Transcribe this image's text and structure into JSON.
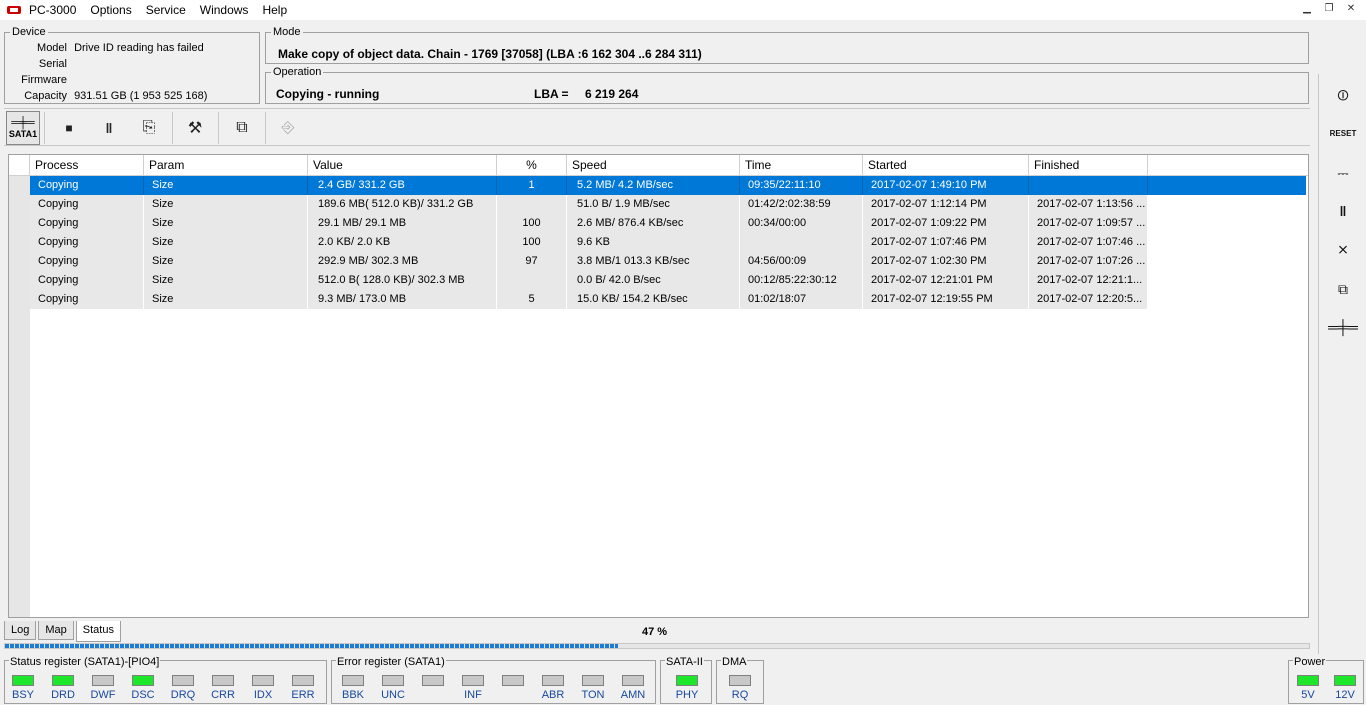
{
  "app": {
    "title": "PC-3000",
    "menu": [
      "Options",
      "Service",
      "Windows",
      "Help"
    ]
  },
  "device": {
    "title": "Device",
    "model_label": "Model",
    "model_value": "Drive ID reading has failed",
    "serial_label": "Serial",
    "firmware_label": "Firmware",
    "capacity_label": "Capacity",
    "capacity_value": "931.51 GB (1 953 525 168)"
  },
  "mode": {
    "title": "Mode",
    "text": "Make copy of object data. Chain - 1769 [37058] (LBA :6 162 304 ..6 284 311)"
  },
  "operation": {
    "title": "Operation",
    "status": "Copying - running",
    "lba_label": "LBA =",
    "lba_value": "6 219 264"
  },
  "toolbar": {
    "sata_label": "SATA1",
    "icons": [
      "stop-icon",
      "pause-icon",
      "export-icon",
      "tools-icon",
      "copy-windows-icon",
      "exit-icon"
    ]
  },
  "table": {
    "headers": [
      "Process",
      "Param",
      "Value",
      "%",
      "Speed",
      "Time",
      "Started",
      "Finished"
    ],
    "rows": [
      [
        "Copying",
        "Size",
        "2.4 GB/ 331.2 GB",
        "1",
        "5.2 MB/ 4.2 MB/sec",
        "09:35/22:11:10",
        "2017-02-07 1:49:10 PM",
        ""
      ],
      [
        "Copying",
        "Size",
        "189.6 MB( 512.0 KB)/ 331.2 GB",
        "",
        "51.0 B/ 1.9 MB/sec",
        "01:42/2:02:38:59",
        "2017-02-07 1:12:14 PM",
        "2017-02-07 1:13:56 ..."
      ],
      [
        "Copying",
        "Size",
        "29.1 MB/ 29.1 MB",
        "100",
        "2.6 MB/ 876.4 KB/sec",
        "00:34/00:00",
        "2017-02-07 1:09:22 PM",
        "2017-02-07 1:09:57 ..."
      ],
      [
        "Copying",
        "Size",
        "2.0 KB/ 2.0 KB",
        "100",
        "9.6 KB",
        "",
        "2017-02-07 1:07:46 PM",
        "2017-02-07 1:07:46 ..."
      ],
      [
        "Copying",
        "Size",
        "292.9 MB/ 302.3 MB",
        "97",
        "3.8 MB/1 013.3 KB/sec",
        "04:56/00:09",
        "2017-02-07 1:02:30 PM",
        "2017-02-07 1:07:26 ..."
      ],
      [
        "Copying",
        "Size",
        "512.0 B( 128.0 KB)/ 302.3 MB",
        "",
        "0.0 B/ 42.0 B/sec",
        "00:12/85:22:30:12",
        "2017-02-07 12:21:01 PM",
        "2017-02-07 12:21:1..."
      ],
      [
        "Copying",
        "Size",
        "9.3 MB/ 173.0 MB",
        "5",
        "15.0 KB/ 154.2 KB/sec",
        "01:02/18:07",
        "2017-02-07 12:19:55 PM",
        "2017-02-07 12:20:5..."
      ]
    ]
  },
  "tabs": [
    "Log",
    "Map",
    "Status"
  ],
  "progress": {
    "text": "47 %",
    "fraction": 0.47
  },
  "status_register": {
    "title": "Status register (SATA1)-[PIO4]",
    "leds": [
      {
        "label": "BSY",
        "on": true
      },
      {
        "label": "DRD",
        "on": true
      },
      {
        "label": "DWF",
        "on": false
      },
      {
        "label": "DSC",
        "on": true
      },
      {
        "label": "DRQ",
        "on": false
      },
      {
        "label": "CRR",
        "on": false
      },
      {
        "label": "IDX",
        "on": false
      },
      {
        "label": "ERR",
        "on": false
      }
    ]
  },
  "error_register": {
    "title": "Error register (SATA1)",
    "leds": [
      {
        "label": "BBK",
        "on": false
      },
      {
        "label": "UNC",
        "on": false
      },
      {
        "label": "",
        "on": false
      },
      {
        "label": "INF",
        "on": false
      },
      {
        "label": "",
        "on": false
      },
      {
        "label": "ABR",
        "on": false
      },
      {
        "label": "TON",
        "on": false
      },
      {
        "label": "AMN",
        "on": false
      }
    ]
  },
  "sata2": {
    "title": "SATA-II",
    "label": "PHY",
    "on": true
  },
  "dma": {
    "title": "DMA",
    "label": "RQ",
    "on": false
  },
  "power": {
    "title": "Power",
    "leds": [
      {
        "label": "5V",
        "on": true
      },
      {
        "label": "12V",
        "on": true
      }
    ]
  },
  "colors": {
    "selection": "#0078d7",
    "led_on": "#1ee62a",
    "led_off": "#c8c8c8",
    "progress": "#1c7bd8"
  }
}
